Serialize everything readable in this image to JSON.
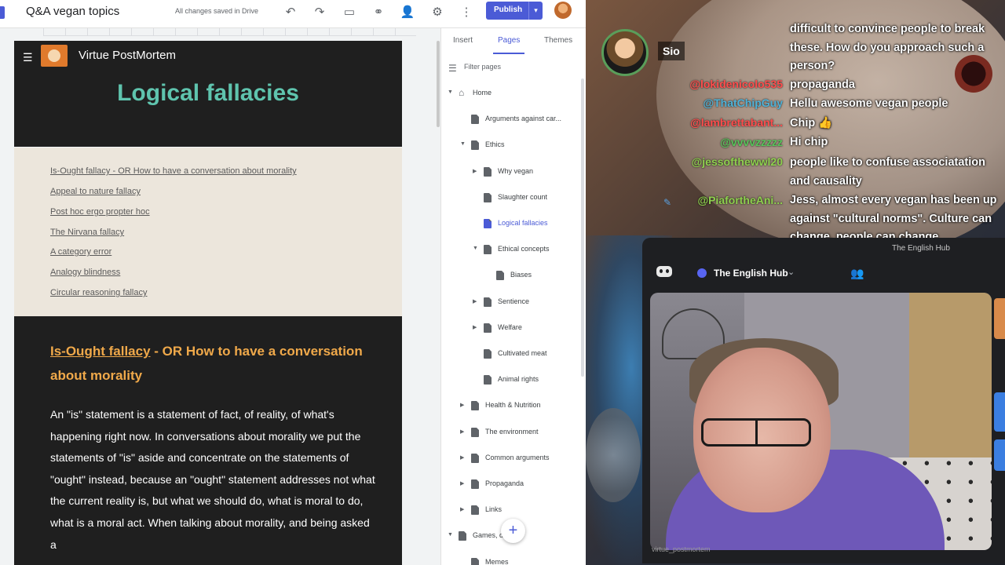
{
  "editor": {
    "doc_title": "Q&A vegan topics",
    "save_status": "All changes saved in Drive",
    "publish_label": "Publish",
    "toolbar_icons": [
      "undo-icon",
      "redo-icon",
      "preview-icon",
      "link-icon",
      "share-icon",
      "settings-icon",
      "more-icon"
    ],
    "accent_color": "#4b5bd6"
  },
  "site": {
    "name": "Virtue PostMortem",
    "page_title": "Logical fallacies",
    "toc": [
      "Is-Ought fallacy - OR How to have a conversation about morality",
      "Appeal to nature fallacy",
      "Post hoc ergo propter hoc",
      "The Nirvana fallacy",
      "A category error",
      "Analogy blindness",
      "Circular reasoning fallacy"
    ],
    "section_title_link": "Is-Ought fallacy",
    "section_title_rest": " - OR How to have a conversation about morality",
    "body": "An \"is\" statement is a statement of fact, of reality, of what's happening right now. In conversations about morality we put the statements of \"is\" aside and concentrate on the statements of \"ought\" instead, because an \"ought\" statement addresses not what the current reality is, but what we should do, what is moral to do, what is a moral act. When talking about morality, and being asked a"
  },
  "panel": {
    "tabs": [
      "Insert",
      "Pages",
      "Themes"
    ],
    "active_tab": "Pages",
    "filter_placeholder": "Filter pages",
    "pages": [
      {
        "label": "Home",
        "arrow": "down"
      },
      {
        "label": "Arguments against car...",
        "arrow": ""
      },
      {
        "label": "Ethics",
        "arrow": "down"
      },
      {
        "label": "Why vegan",
        "arrow": "right"
      },
      {
        "label": "Slaughter count",
        "arrow": ""
      },
      {
        "label": "Logical fallacies",
        "arrow": "",
        "selected": true
      },
      {
        "label": "Ethical concepts",
        "arrow": "down"
      },
      {
        "label": "Biases",
        "arrow": ""
      },
      {
        "label": "Sentience",
        "arrow": "right"
      },
      {
        "label": "Welfare",
        "arrow": "right"
      },
      {
        "label": "Cultivated meat",
        "arrow": ""
      },
      {
        "label": "Animal rights",
        "arrow": ""
      },
      {
        "label": "Health & Nutrition",
        "arrow": "right"
      },
      {
        "label": "The environment",
        "arrow": "right"
      },
      {
        "label": "Common arguments",
        "arrow": "right"
      },
      {
        "label": "Propaganda",
        "arrow": "right"
      },
      {
        "label": "Links",
        "arrow": "right"
      },
      {
        "label": "Games,                 d Fun",
        "arrow": "down"
      },
      {
        "label": "Memes",
        "arrow": ""
      }
    ],
    "fab_symbol": "+"
  },
  "stream": {
    "featured_chatter": "Sio",
    "messages": [
      {
        "user": "",
        "color": "#ffffff",
        "text": "difficult to convince people to break these. How do you approach such a person?"
      },
      {
        "user": "@lokidenicolo535",
        "color": "#ff4d4d",
        "text": "propaganda"
      },
      {
        "user": "@ThatChipGuy",
        "color": "#4fb3d9",
        "text": "Hellu awesome vegan people"
      },
      {
        "user": "@lambrettabant...",
        "color": "#ff4d4d",
        "text": "Chip 👍"
      },
      {
        "user": "@vvvvzzzzz",
        "color": "#58c45a",
        "text": "Hi chip"
      },
      {
        "user": "@jessofthewwl20",
        "color": "#8fd14f",
        "text": "people like to confuse associatation and causality"
      },
      {
        "user": "@PiafortheAni...",
        "color": "#8fd14f",
        "text": "Jess, almost every vegan has been up against \"cultural norms\". Culture can change, people can change"
      }
    ],
    "discord": {
      "server": "The English Hub",
      "tag": "The English Hub",
      "footer_user": "virtue_postmortem"
    }
  }
}
